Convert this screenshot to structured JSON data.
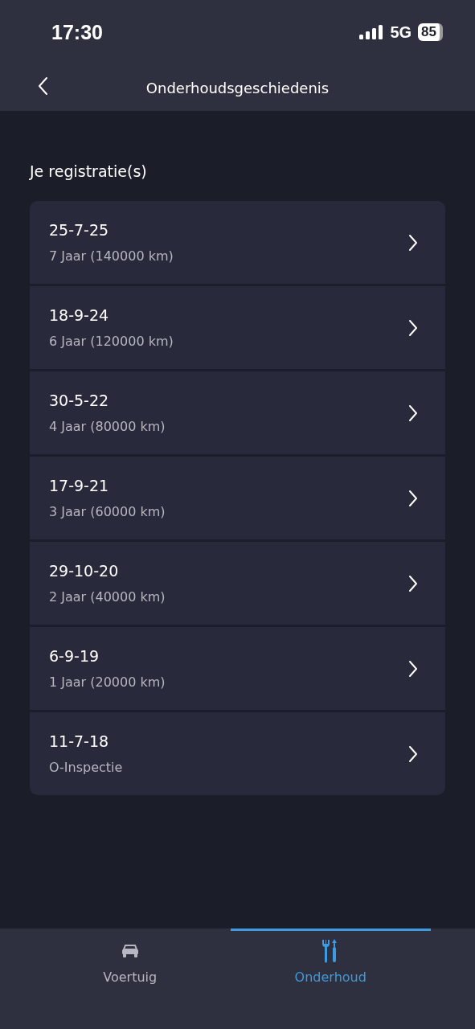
{
  "status_bar": {
    "time": "17:30",
    "network": "5G",
    "battery": "85"
  },
  "nav_bar": {
    "title": "Onderhoudsgeschiedenis"
  },
  "section_title": "Je registratie(s)",
  "registrations": [
    {
      "date": "25-7-25",
      "description": "7 Jaar (140000 km)"
    },
    {
      "date": "18-9-24",
      "description": "6 Jaar (120000 km)"
    },
    {
      "date": "30-5-22",
      "description": "4 Jaar (80000 km)"
    },
    {
      "date": "17-9-21",
      "description": "3 Jaar (60000 km)"
    },
    {
      "date": "29-10-20",
      "description": "2 Jaar (40000 km)"
    },
    {
      "date": "6-9-19",
      "description": "1 Jaar (20000 km)"
    },
    {
      "date": "11-7-18",
      "description": "O-Inspectie"
    }
  ],
  "tabs": [
    {
      "label": "Voertuig",
      "kind": "car",
      "selected": false
    },
    {
      "label": "Onderhoud",
      "kind": "tools",
      "selected": true
    }
  ]
}
